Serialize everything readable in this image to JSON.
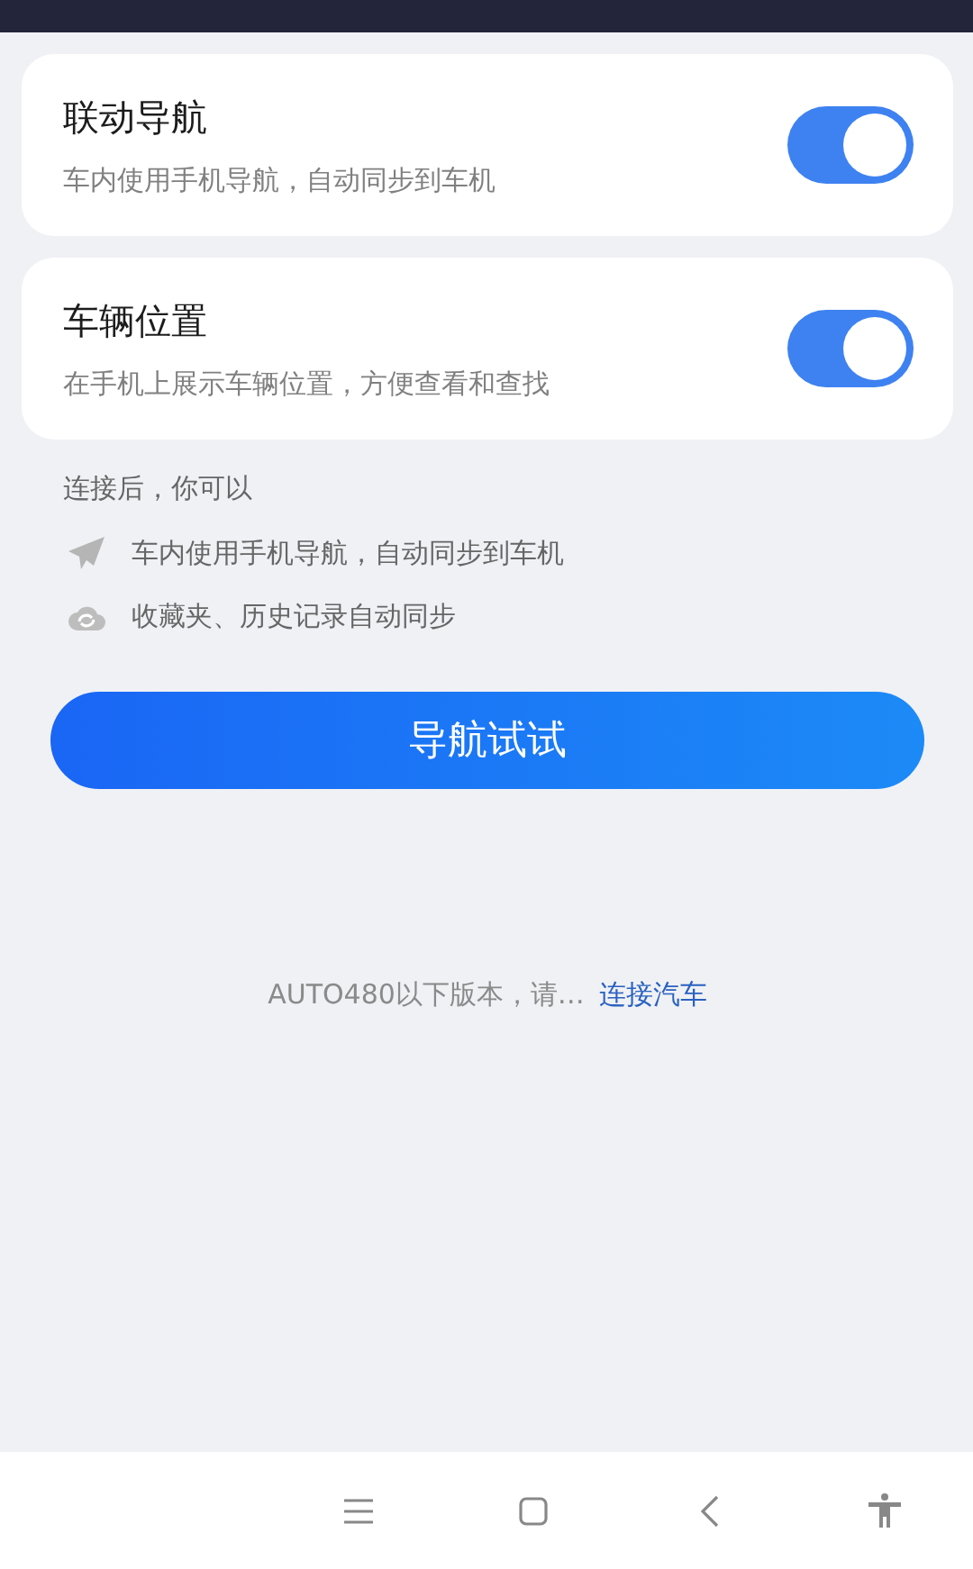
{
  "settings": [
    {
      "title": "联动导航",
      "description": "车内使用手机导航，自动同步到车机",
      "on": true
    },
    {
      "title": "车辆位置",
      "description": "在手机上展示车辆位置，方便查看和查找",
      "on": true
    }
  ],
  "features": {
    "heading": "连接后，你可以",
    "items": [
      {
        "kind": "plane",
        "text": "车内使用手机导航，自动同步到车机"
      },
      {
        "kind": "cloud",
        "text": "收藏夹、历史记录自动同步"
      }
    ]
  },
  "primary_button": "导航试试",
  "footer": {
    "note": "AUTO480以下版本，请…",
    "link": "连接汽车"
  }
}
